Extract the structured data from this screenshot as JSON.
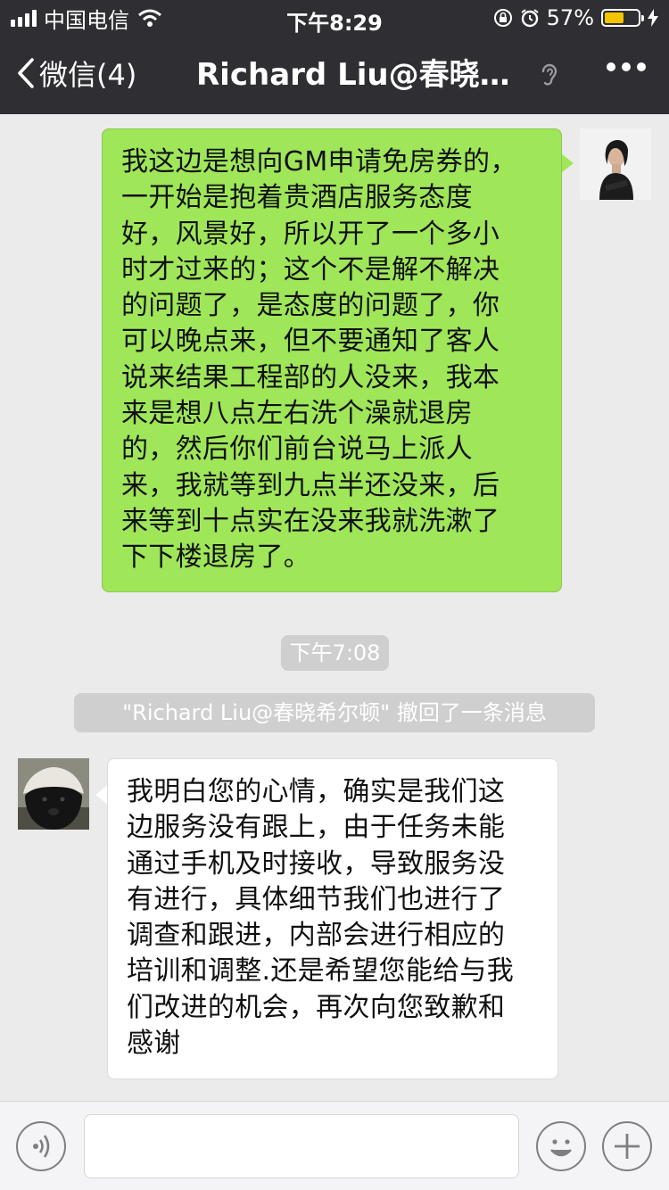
{
  "status_bar": {
    "carrier": "中国电信",
    "time": "下午8:29",
    "battery_percent": "57%",
    "battery_level": 0.57,
    "signal_bars": 4,
    "battery_color": "#f5c400"
  },
  "nav": {
    "back_label": "微信(4)",
    "title": "Richard Liu@春晓希…",
    "icons": [
      "chevron-left-icon",
      "ear-icon",
      "more-icon"
    ]
  },
  "messages": {
    "sent_1": "我这边是想向GM申请免房券的，\n一开始是抱着贵酒店服务态度\n好，风景好，所以开了一个多小\n时才过来的；这个不是解不解决\n的问题了，是态度的问题了，你\n可以晚点来，但不要通知了客人\n说来结果工程部的人没来，我本\n来是想八点左右洗个澡就退房\n的，然后你们前台说马上派人\n来，我就等到九点半还没来，后\n来等到十点实在没来我就洗漱了\n下下楼退房了。",
    "timestamp": "下午7:08",
    "recall_notice": "\"Richard Liu@春晓希尔顿\" 撤回了一条消息",
    "received_1": "我明白您的心情，确实是我们这\n边服务没有跟上，由于任务未能\n通过手机及时接收，导致服务没\n有进行，具体细节我们也进行了\n调查和跟进，内部会进行相应的\n培训和调整.还是希望您能给与我\n们改进的机会，再次向您致歉和\n感谢"
  },
  "colors": {
    "header_bg": "#2e2e33",
    "chat_bg": "#ebebeb",
    "sent_bubble": "#9fe659",
    "received_bubble": "#ffffff"
  },
  "input_bar": {
    "placeholder": "",
    "icons": [
      "voice-icon",
      "emoji-icon",
      "plus-icon"
    ]
  }
}
